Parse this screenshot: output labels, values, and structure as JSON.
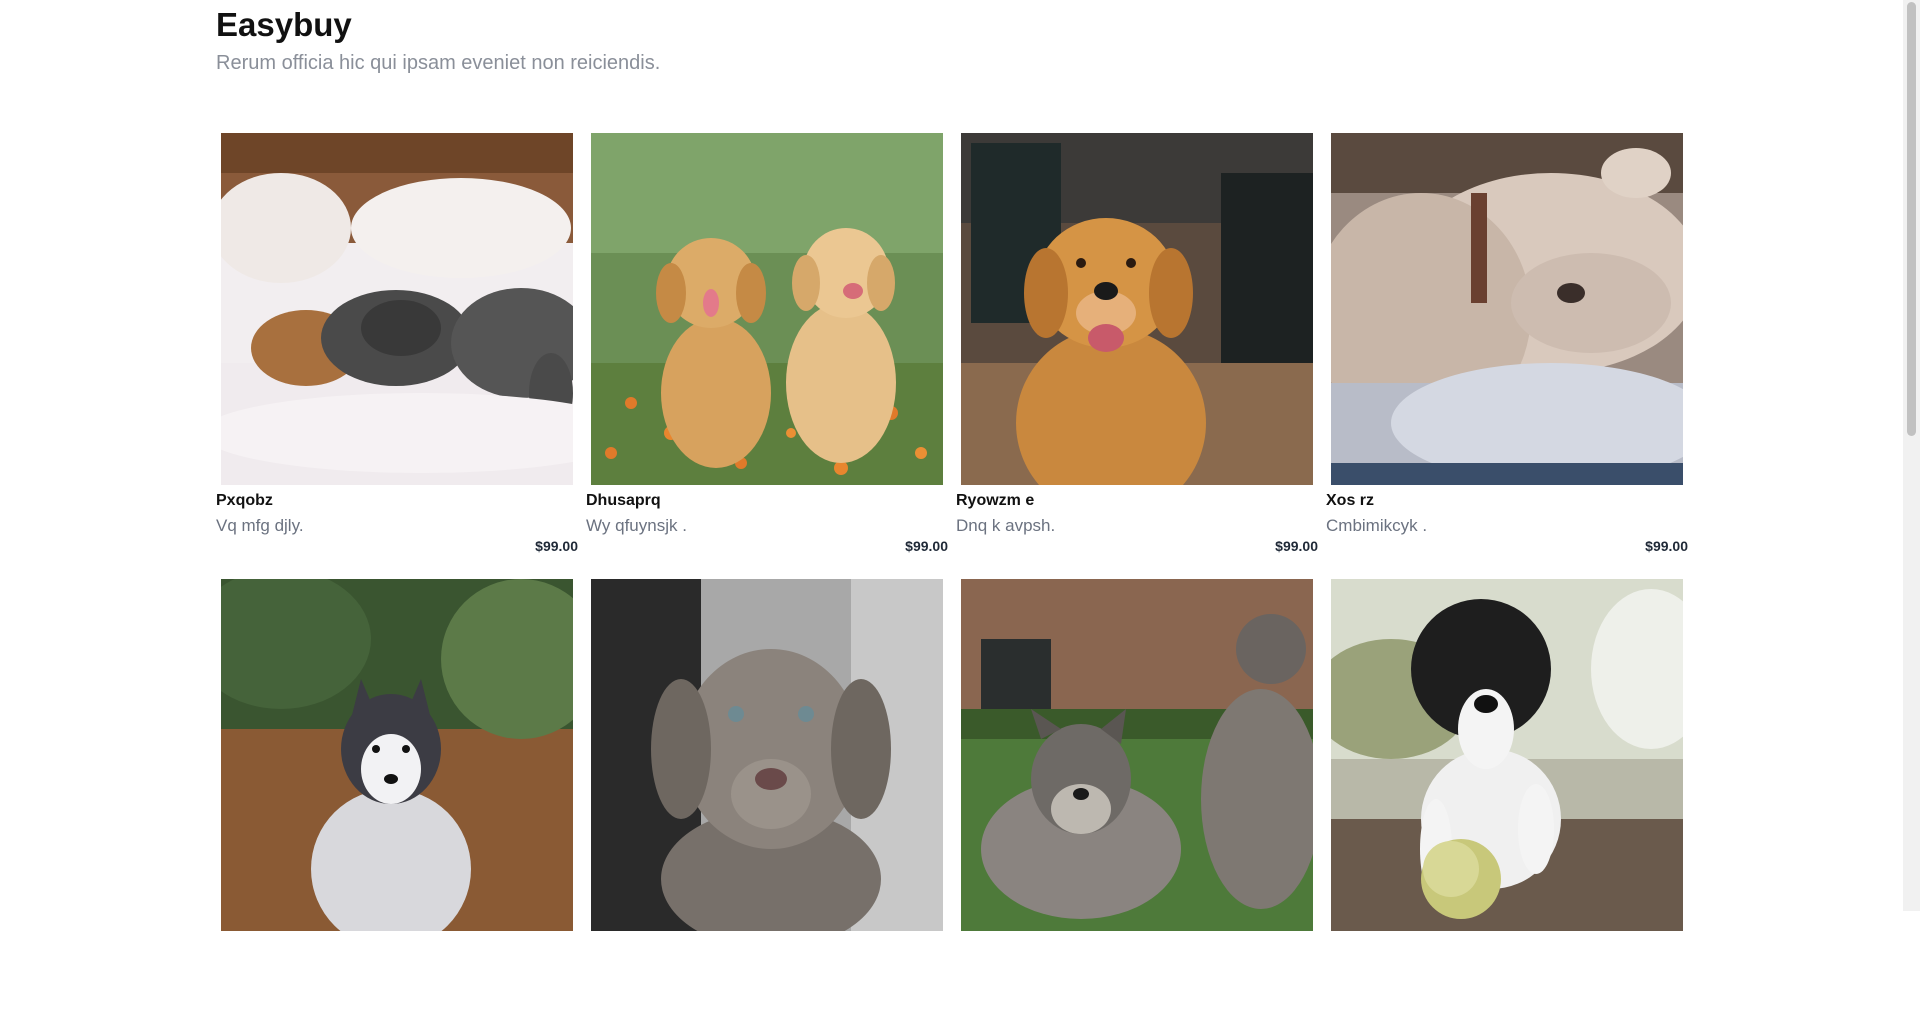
{
  "header": {
    "title": "Easybuy",
    "subtitle": "Rerum officia hic qui ipsam eveniet non reiciendis."
  },
  "products": [
    {
      "name": "Pxqobz",
      "description": "Vq mfg djly.",
      "price": "$99.00",
      "image": "dogs-sleeping-on-bed"
    },
    {
      "name": "Dhusaprq",
      "description": "Wy qfuynsjk .",
      "price": "$99.00",
      "image": "two-golden-puppies-in-flowers"
    },
    {
      "name": "Ryowzm e",
      "description": "Dnq k avpsh.",
      "price": "$99.00",
      "image": "smiling-golden-retriever"
    },
    {
      "name": "Xos rz",
      "description": "Cmbimikcyk .",
      "price": "$99.00",
      "image": "dog-sleeping-closeup"
    },
    {
      "name": "",
      "description": "",
      "price": "",
      "image": "husky-puppy-in-forest"
    },
    {
      "name": "",
      "description": "",
      "price": "",
      "image": "weimaraner-puppy-portrait"
    },
    {
      "name": "",
      "description": "",
      "price": "",
      "image": "schnauzers-on-lawn"
    },
    {
      "name": "",
      "description": "",
      "price": "",
      "image": "border-collie-with-ball"
    }
  ],
  "colors": {
    "title": "#111111",
    "subtitle": "#8a8f99",
    "description": "#6b7280",
    "price": "#1f2937"
  }
}
